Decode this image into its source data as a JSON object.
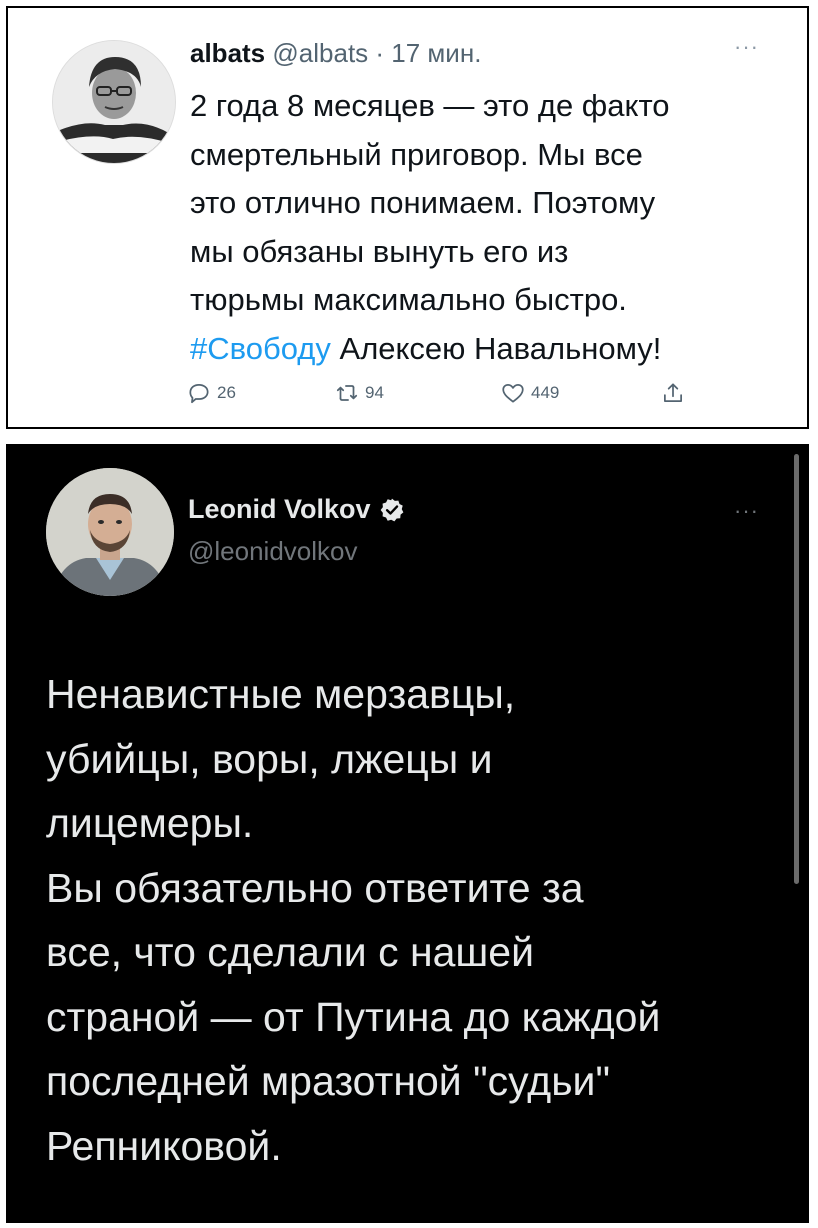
{
  "tweet1": {
    "name": "albats",
    "handle": "@albats",
    "time": "· 17 мин.",
    "more": "···",
    "lines": [
      "2 года 8 месяцев — это де факто",
      "смертельный приговор. Мы все",
      "это отлично понимаем. Поэтому",
      "мы обязаны вынуть его из",
      "тюрьмы максимально быстро."
    ],
    "hashtag": "#Свободу",
    "last_line_rest": " Алексею Навальному!",
    "replies": "26",
    "retweets": "94",
    "likes": "449",
    "colors": {
      "link": "#1d9bf0",
      "text": "#0f1419",
      "muted": "#536471"
    }
  },
  "tweet2": {
    "name": "Leonid Volkov",
    "handle": "@leonidvolkov",
    "verified": true,
    "more": "···",
    "lines": [
      "Ненавистные мерзавцы,",
      "убийцы, воры, лжецы и",
      "лицемеры.",
      "Вы обязательно ответите за",
      "все, что сделали с нашей",
      "страной — от Путина до каждой",
      "последней мразотной \"судьи\"",
      "Репниковой."
    ],
    "colors": {
      "background": "#000000",
      "text": "#e7e9ea",
      "muted": "#71767b",
      "verified": "#1d9bf0"
    }
  }
}
